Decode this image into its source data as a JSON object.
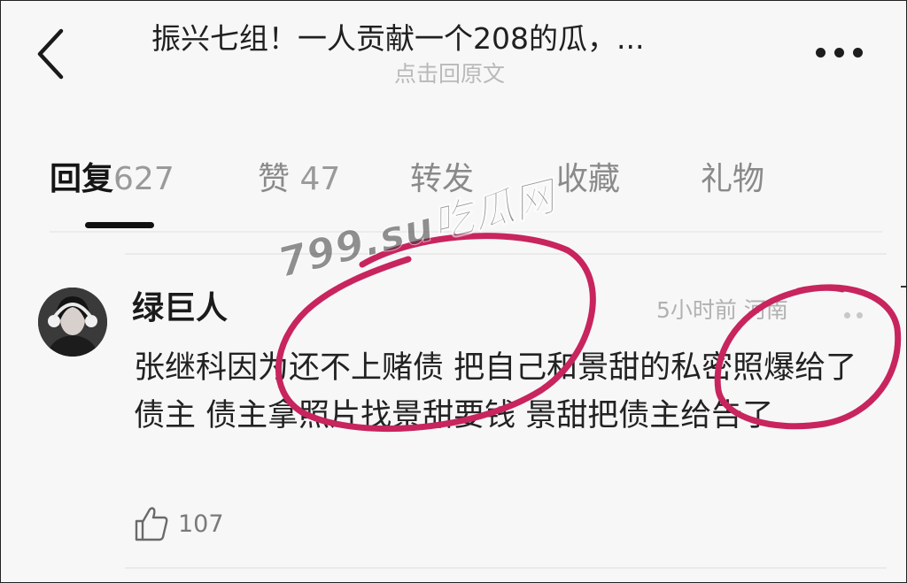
{
  "header": {
    "title": "振兴七组！一人贡献一个208的瓜，...",
    "subtitle": "点击回原文",
    "back_icon": "chevron-left-icon",
    "more_icon": "more-horizontal-icon"
  },
  "tabs": [
    {
      "label": "回复",
      "count": "627",
      "active": true
    },
    {
      "label": "赞",
      "count": "47",
      "active": false
    },
    {
      "label": "转发",
      "count": "",
      "active": false
    },
    {
      "label": "收藏",
      "count": "",
      "active": false
    },
    {
      "label": "礼物",
      "count": "",
      "active": false
    }
  ],
  "comment": {
    "username": "绿巨人",
    "meta": "5小时前 河南",
    "text": "张继科因为还不上赌债 把自己和景甜的私密照爆给了债主 债主拿照片找景甜要钱 景甜把债主给告了",
    "like_count": "107",
    "like_icon": "thumbs-up-icon"
  },
  "watermark": "799.su吃瓜网",
  "colors": {
    "background": "#f7f7f7",
    "text_primary": "#1c1c1c",
    "text_secondary": "#b1b1b1",
    "annotation": "#c8245e"
  }
}
